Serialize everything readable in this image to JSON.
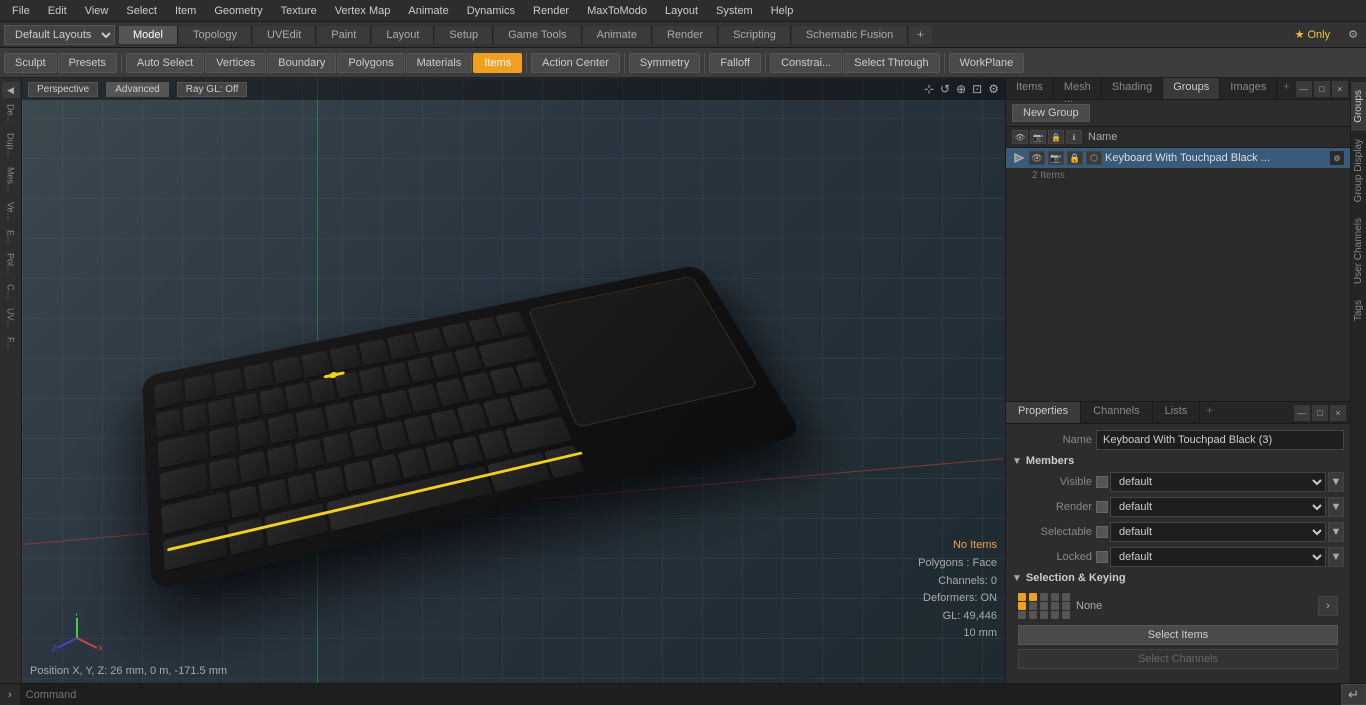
{
  "menu": {
    "items": [
      "File",
      "Edit",
      "View",
      "Select",
      "Item",
      "Geometry",
      "Texture",
      "Vertex Map",
      "Animate",
      "Dynamics",
      "Render",
      "MaxToModo",
      "Layout",
      "System",
      "Help"
    ]
  },
  "layout_bar": {
    "dropdown": "Default Layouts",
    "tabs": [
      "Model",
      "Topology",
      "UVEdit",
      "Paint",
      "Layout",
      "Setup",
      "Game Tools",
      "Animate",
      "Render",
      "Scripting",
      "Schematic Fusion"
    ],
    "active_tab": "Model",
    "star_label": "★ Only",
    "add_label": "+"
  },
  "toolbar": {
    "sculpt": "Sculpt",
    "presets": "Presets",
    "auto_select": "Auto Select",
    "vertices": "Vertices",
    "boundary": "Boundary",
    "polygons": "Polygons",
    "materials": "Materials",
    "items": "Items",
    "action_center": "Action Center",
    "symmetry": "Symmetry",
    "falloff": "Falloff",
    "constraints": "Constrai...",
    "select_through": "Select Through",
    "work_plane": "WorkPlane"
  },
  "viewport": {
    "perspective": "Perspective",
    "advanced": "Advanced",
    "ray_gl": "Ray GL: Off"
  },
  "stats": {
    "no_items": "No Items",
    "polygons": "Polygons : Face",
    "channels": "Channels: 0",
    "deformers": "Deformers: ON",
    "gl": "GL: 49,446",
    "size": "10 mm"
  },
  "coords": "Position X, Y, Z:   26 mm, 0 m, -171.5 mm",
  "right_panel": {
    "tabs": [
      "Items",
      "Mesh ...",
      "Shading",
      "Groups",
      "Images"
    ],
    "active_tab": "Groups",
    "add_label": "+",
    "col_header": "Name",
    "new_group_btn": "New Group",
    "group_name": "Keyboard With Touchpad Black ...",
    "group_name_full": "Keyboard With Touchpad Black",
    "group_count": "2 Items"
  },
  "properties": {
    "tabs": [
      "Properties",
      "Channels",
      "Lists"
    ],
    "active_tab": "Properties",
    "add_label": "+",
    "name_label": "Name",
    "name_value": "Keyboard With Touchpad Black (3)",
    "members_label": "Members",
    "visible_label": "Visible",
    "visible_value": "default",
    "render_label": "Render",
    "render_value": "default",
    "selectable_label": "Selectable",
    "selectable_value": "default",
    "locked_label": "Locked",
    "locked_value": "default",
    "sel_keying_label": "Selection & Keying",
    "none_label": "None",
    "select_items_btn": "Select Items",
    "select_channels_btn": "Select Channels"
  },
  "vtabs": [
    "Groups",
    "Group Display",
    "User Channels",
    "Tags"
  ],
  "command": {
    "placeholder": "Command",
    "arrow": "›"
  }
}
